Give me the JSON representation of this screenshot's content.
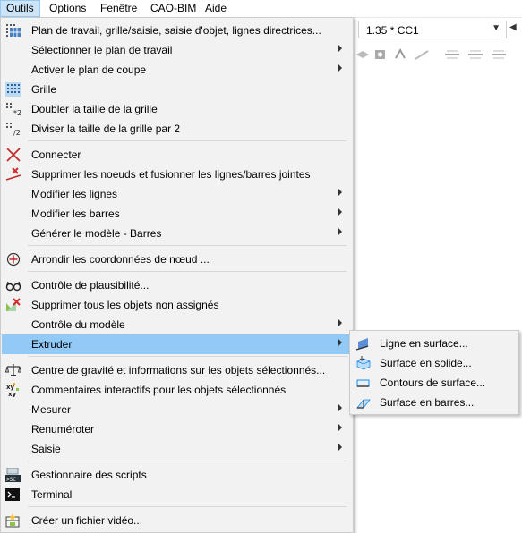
{
  "menubar": {
    "items": [
      {
        "label": "Outils",
        "active": true
      },
      {
        "label": "Options"
      },
      {
        "label": "Fenêtre"
      },
      {
        "label": "CAO-BIM"
      },
      {
        "label": "Aide"
      }
    ]
  },
  "toolbar": {
    "combo_value": "1.35 * CC1"
  },
  "menu": {
    "items": [
      {
        "label": "Plan de travail, grille/saisie, saisie d'objet, lignes directrices...",
        "icon": "workplane-grid-icon",
        "submenu": false
      },
      {
        "label": "Sélectionner le plan de travail",
        "icon": "",
        "submenu": true
      },
      {
        "label": "Activer le plan de coupe",
        "icon": "",
        "submenu": true
      },
      {
        "label": "Grille",
        "icon": "grid-icon",
        "submenu": false
      },
      {
        "label": "Doubler la taille de la grille",
        "icon": "grid-double-icon",
        "submenu": false
      },
      {
        "label": "Diviser la taille de la grille par 2",
        "icon": "grid-half-icon",
        "submenu": false
      },
      {
        "label": "Connecter",
        "icon": "connect-icon",
        "submenu": false
      },
      {
        "label": "Supprimer les noeuds et fusionner les lignes/barres jointes",
        "icon": "delete-nodes-merge-icon",
        "submenu": false
      },
      {
        "label": "Modifier les lignes",
        "icon": "",
        "submenu": true
      },
      {
        "label": "Modifier les barres",
        "icon": "",
        "submenu": true
      },
      {
        "label": "Générer le modèle - Barres",
        "icon": "",
        "submenu": true
      },
      {
        "label": "Arrondir les coordonnées de nœud ...",
        "icon": "round-coordinates-icon",
        "submenu": false
      },
      {
        "label": "Contrôle de plausibilité...",
        "icon": "glasses-icon",
        "submenu": false
      },
      {
        "label": "Supprimer tous les objets non assignés",
        "icon": "delete-unassigned-icon",
        "submenu": false
      },
      {
        "label": "Contrôle du modèle",
        "icon": "",
        "submenu": true
      },
      {
        "label": "Extruder",
        "icon": "",
        "submenu": true,
        "highlighted": true
      },
      {
        "label": "Centre de gravité et informations sur les objets sélectionnés...",
        "icon": "center-of-gravity-icon",
        "submenu": false
      },
      {
        "label": "Commentaires interactifs pour les objets sélectionnés",
        "icon": "interactive-comments-icon",
        "submenu": false
      },
      {
        "label": "Mesurer",
        "icon": "",
        "submenu": true
      },
      {
        "label": "Renuméroter",
        "icon": "",
        "submenu": true
      },
      {
        "label": "Saisie",
        "icon": "",
        "submenu": true
      },
      {
        "label": "Gestionnaire des scripts",
        "icon": "script-manager-icon",
        "submenu": false
      },
      {
        "label": "Terminal",
        "icon": "terminal-icon",
        "submenu": false
      },
      {
        "label": "Créer un fichier vidéo...",
        "icon": "create-video-icon",
        "submenu": false
      }
    ]
  },
  "submenu": {
    "items": [
      {
        "label": "Ligne en surface...",
        "icon": "line-to-surface-icon"
      },
      {
        "label": "Surface en solide...",
        "icon": "surface-to-solid-icon"
      },
      {
        "label": "Contours de surface...",
        "icon": "surface-contours-icon"
      },
      {
        "label": "Surface en barres...",
        "icon": "surface-to-members-icon"
      }
    ]
  },
  "colors": {
    "highlight": "#91c9f7",
    "menubar_active": "#cce4f7",
    "menu_bg": "#f2f2f2"
  }
}
